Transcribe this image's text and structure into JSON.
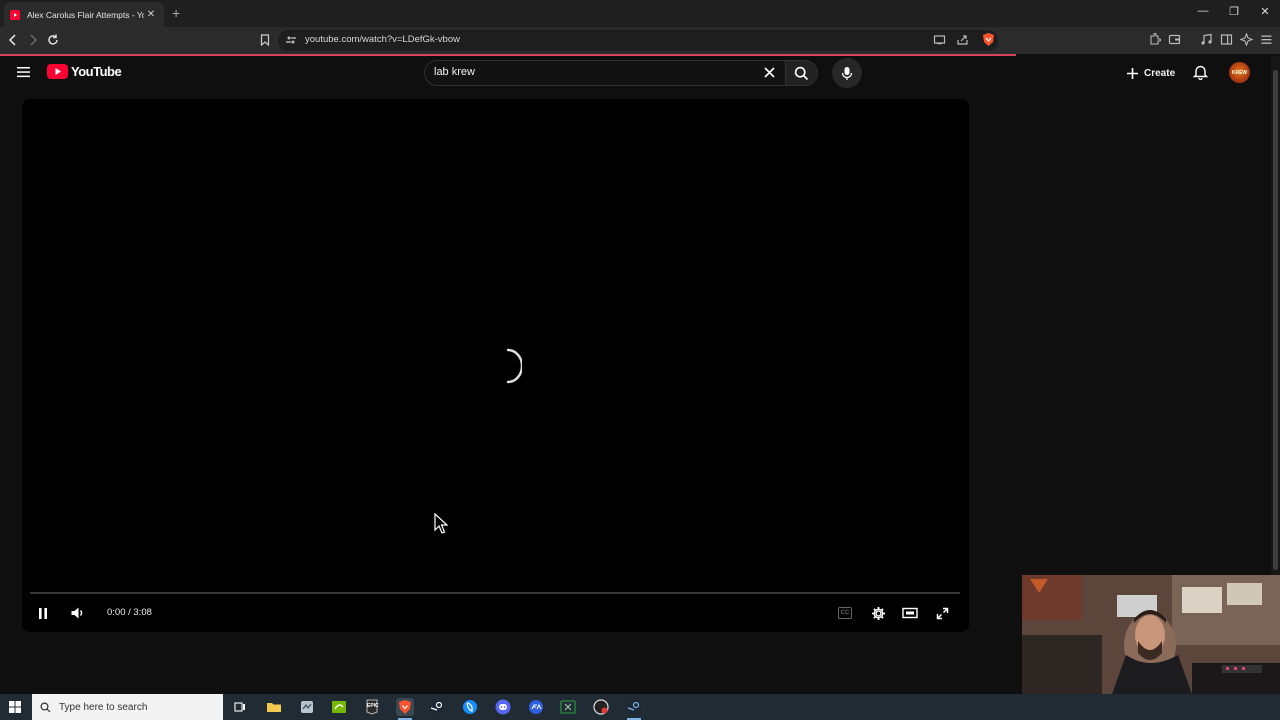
{
  "browser": {
    "tab_title": "Alex Carolus Flair Attempts - YouTube",
    "url": "youtube.com/watch?v=LDefGk-vbow",
    "new_tab": "+",
    "tab_close": "✕",
    "window_minimize": "—",
    "window_restore": "❐",
    "window_close": "✕"
  },
  "youtube": {
    "logo_text": "YouTube",
    "search_value": "lab krew",
    "create_label": "Create",
    "avatar_label": "KREW"
  },
  "player": {
    "time_display": "0:00 / 3:08",
    "current_time": "0:00",
    "duration": "3:08",
    "state": "loading",
    "cc_label": "CC"
  },
  "taskbar": {
    "search_placeholder": "Type here to search",
    "epic_label": "EPIC"
  },
  "colors": {
    "youtube_red": "#ff0033",
    "load_bar": "#d9435e",
    "brave_orange": "#fb542b",
    "taskbar": "#202b33"
  }
}
